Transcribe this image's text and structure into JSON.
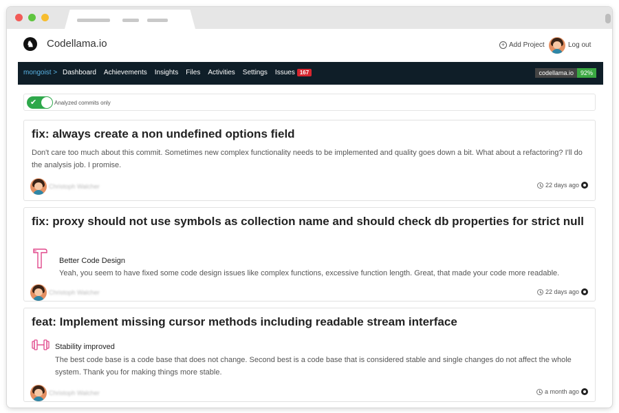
{
  "app": {
    "brand": "Codellama.io",
    "add_project_label": "Add Project",
    "logout_label": "Log out"
  },
  "nav": {
    "breadcrumb": "mongoist >",
    "items": [
      {
        "label": "Dashboard"
      },
      {
        "label": "Achievements"
      },
      {
        "label": "Insights"
      },
      {
        "label": "Files"
      },
      {
        "label": "Activities"
      },
      {
        "label": "Settings"
      },
      {
        "label": "Issues",
        "badge": "167"
      }
    ],
    "score_name": "codellama.io",
    "score_value": "92%",
    "score_color": "#3aa842",
    "badge_color": "#d7262f"
  },
  "filter": {
    "label": "Analyzed commits only",
    "enabled": true
  },
  "commits": [
    {
      "title": "fix: always create a non undefined options field",
      "description": "Don't care too much about this commit. Sometimes new complex functionality needs to be implemented and quality goes down a bit. What about a refactoring? I'll do the analysis job. I promise.",
      "author": "Christoph Walcher",
      "time": "22 days ago"
    },
    {
      "title": "fix: proxy should not use symbols as collection name and should check db properties for strict null",
      "insight_icon": "hammer-icon",
      "insight_title": "Better Code Design",
      "insight_text": "Yeah, you seem to have fixed some code design issues like complex functions, excessive function length. Great, that made your code more readable.",
      "author": "Christoph Walcher",
      "time": "22 days ago"
    },
    {
      "title": "feat: Implement missing cursor methods including readable stream interface",
      "insight_icon": "dumbbell-icon",
      "insight_title": "Stability improved",
      "insight_text": "The best code base is a code base that does not change. Second best is a code base that is considered stable and single changes do not affect the whole system. Thank you for making things more stable.",
      "author": "Christoph Walcher",
      "time": "a month ago"
    }
  ]
}
